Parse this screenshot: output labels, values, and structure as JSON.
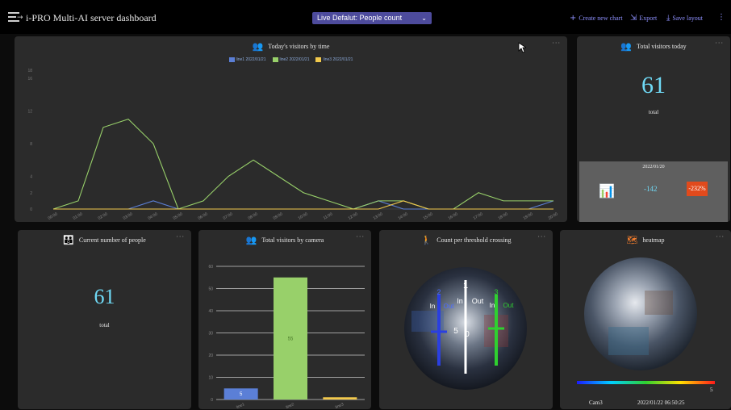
{
  "header": {
    "title": "i-PRO Multi-AI server dashboard",
    "preset": "Live Defalut: People count",
    "actions": {
      "create": "Create new chart",
      "export": "Export",
      "save": "Save layout"
    },
    "more": "⋮"
  },
  "panels": {
    "visitors_by_time": {
      "title": "Today's visitors by time",
      "more": "···"
    },
    "total_today": {
      "title": "Total visitors today",
      "value": "61",
      "value_label": "total",
      "more": "···",
      "compare": {
        "date": "2022/01/20",
        "diff": "-142",
        "percent": "-232%"
      }
    },
    "current_people": {
      "title": "Current number of people",
      "value": "61",
      "value_label": "total",
      "more": "···"
    },
    "by_camera": {
      "title": "Total visitors by camera",
      "more": "···"
    },
    "threshold": {
      "title": "Count per threshold crossing",
      "more": "···",
      "line_labels": {
        "n1": "1",
        "n2": "2",
        "n3": "3",
        "in1": "In",
        "out1": "Out",
        "in2": "In",
        "out2": "Out",
        "in3": "In",
        "out3": "Out",
        "count1": "5",
        "count2": "0"
      }
    },
    "heatmap": {
      "title": "heatmap",
      "more": "···",
      "scale_max": "5",
      "camera": "Cam3",
      "timestamp": "2022/01/22 06:50:25"
    }
  },
  "chart_data": [
    {
      "type": "line",
      "title": "Today's visitors by time",
      "x": [
        "00:00",
        "01:00",
        "02:00",
        "03:00",
        "04:00",
        "05:00",
        "06:00",
        "07:00",
        "08:00",
        "09:00",
        "10:00",
        "11:00",
        "12:00",
        "13:00",
        "14:00",
        "15:00",
        "16:00",
        "17:00",
        "18:00",
        "19:00",
        "20:00"
      ],
      "ylim": [
        0,
        16
      ],
      "yticks": [
        "0",
        "2",
        "4",
        "8",
        "12",
        "16",
        "18"
      ],
      "grid": false,
      "legend_position": "top",
      "series": [
        {
          "name": "line1 2022/01/21",
          "color": "#5b7fd6",
          "values": [
            0,
            0,
            0,
            0,
            1,
            0,
            0,
            0,
            0,
            0,
            0,
            0,
            0,
            1,
            0,
            0,
            0,
            0,
            0,
            0,
            1
          ]
        },
        {
          "name": "line2 2022/01/21",
          "color": "#98d06a",
          "values": [
            0,
            1,
            10,
            11,
            8,
            0,
            1,
            4,
            6,
            4,
            2,
            1,
            0,
            1,
            1,
            0,
            0,
            2,
            1,
            1,
            1
          ]
        },
        {
          "name": "line3 2022/01/21",
          "color": "#f2c94c",
          "values": [
            0,
            0,
            0,
            0,
            0,
            0,
            0,
            0,
            0,
            0,
            0,
            0,
            0,
            0,
            1,
            0,
            0,
            0,
            0,
            0,
            0
          ]
        }
      ]
    },
    {
      "type": "bar",
      "title": "Total visitors by camera",
      "categories": [
        "line1",
        "line2",
        "line3"
      ],
      "values": [
        5,
        55,
        1
      ],
      "colors": [
        "#5b7fd6",
        "#98d06a",
        "#f2c94c"
      ],
      "data_labels": [
        "5",
        "55",
        ""
      ],
      "ylim": [
        0,
        60
      ],
      "yticks": [
        "0",
        "10",
        "20",
        "30",
        "40",
        "50",
        "60"
      ],
      "grid": true
    }
  ],
  "colors": {
    "accent": "#8f91ff",
    "value": "#6fd9f5",
    "alert": "#e14a1c",
    "panel": "#2b2b2b",
    "icon": "#f07c2d"
  },
  "icons": {
    "menu": "menu-collapse-icon",
    "create": "plus-icon",
    "export": "export-icon",
    "save": "download-icon",
    "people": "people-group-icon",
    "walker": "walking-person-icon",
    "map": "map-icon"
  }
}
